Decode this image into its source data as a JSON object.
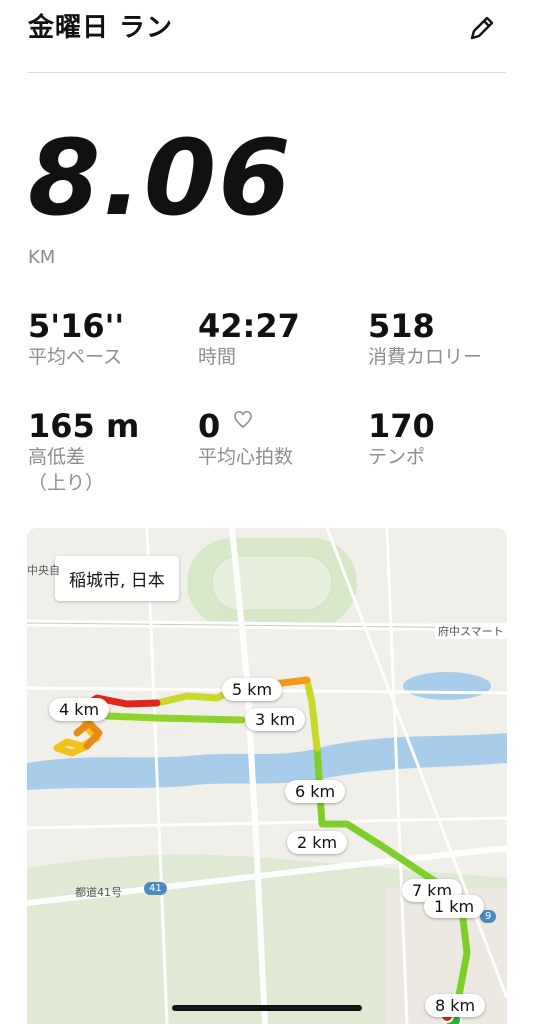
{
  "header": {
    "title": "金曜日 ラン",
    "edit_icon": "pencil-icon"
  },
  "summary": {
    "distance": "8.06",
    "unit": "KM"
  },
  "stats": [
    {
      "value": "5'16''",
      "label": "平均ペース"
    },
    {
      "value": "42:27",
      "label": "時間"
    },
    {
      "value": "518",
      "label": "消費カロリー"
    },
    {
      "value": "165 m",
      "label": "高低差\n（上り）"
    },
    {
      "value": "0",
      "label": "平均心拍数",
      "icon": "heart-outline-icon"
    },
    {
      "value": "170",
      "label": "テンポ"
    }
  ],
  "map": {
    "place": "稲城市, 日本",
    "km_markers": [
      "1 km",
      "2 km",
      "3 km",
      "4 km",
      "5 km",
      "6 km",
      "7 km",
      "8 km"
    ],
    "road_labels": [
      "府中スマート",
      "都道41号",
      "中央自"
    ],
    "route_badges": [
      "41",
      "9"
    ],
    "colors": {
      "slow": "#e0261c",
      "mid": "#f2c21b",
      "fast": "#7fcf2b",
      "water": "#a8cdea",
      "green": "#d6e8c8"
    }
  }
}
